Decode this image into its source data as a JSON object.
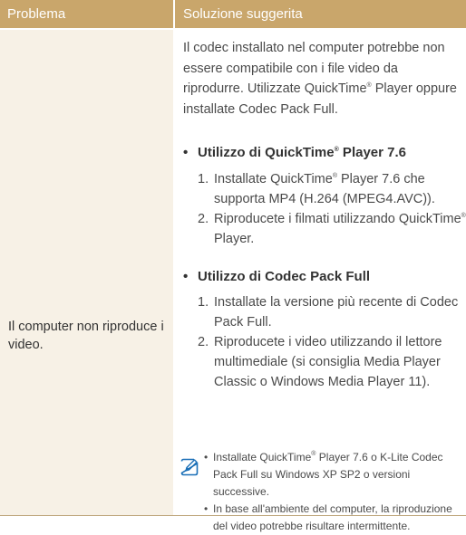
{
  "header": {
    "problem_label": "Problema",
    "solution_label": "Soluzione suggerita"
  },
  "problem": {
    "text": "Il computer non riproduce i video."
  },
  "solution": {
    "intro": "Il codec installato nel computer potrebbe non essere compatibile con i file video da riprodurre. Utilizzate QuickTime® Player oppure installate Codec Pack Full.",
    "sections": [
      {
        "title": "Utilizzo di QuickTime® Player 7.6",
        "steps": [
          "Installate QuickTime® Player 7.6 che supporta MP4 (H.264 (MPEG4.AVC)).",
          "Riproducete i filmati utilizzando QuickTime® Player."
        ]
      },
      {
        "title": "Utilizzo di Codec Pack Full",
        "steps": [
          "Installate la versione più recente di Codec Pack Full.",
          "Riproducete i video utilizzando il lettore multimediale (si consiglia Media Player Classic o Windows Media Player 11)."
        ]
      }
    ],
    "note": {
      "icon": "note-pencil-icon",
      "items": [
        "Installate QuickTime® Player 7.6 o K-Lite Codec Pack Full su Windows XP SP2 o versioni successive.",
        "In base all'ambiente del computer, la riproduzione del video potrebbe risultare intermittente."
      ]
    }
  },
  "colors": {
    "header_bg": "#c9a66b",
    "problem_col_bg": "#f7f1e6",
    "text": "#4a4a4a",
    "note_icon": "#1a6fb7"
  }
}
